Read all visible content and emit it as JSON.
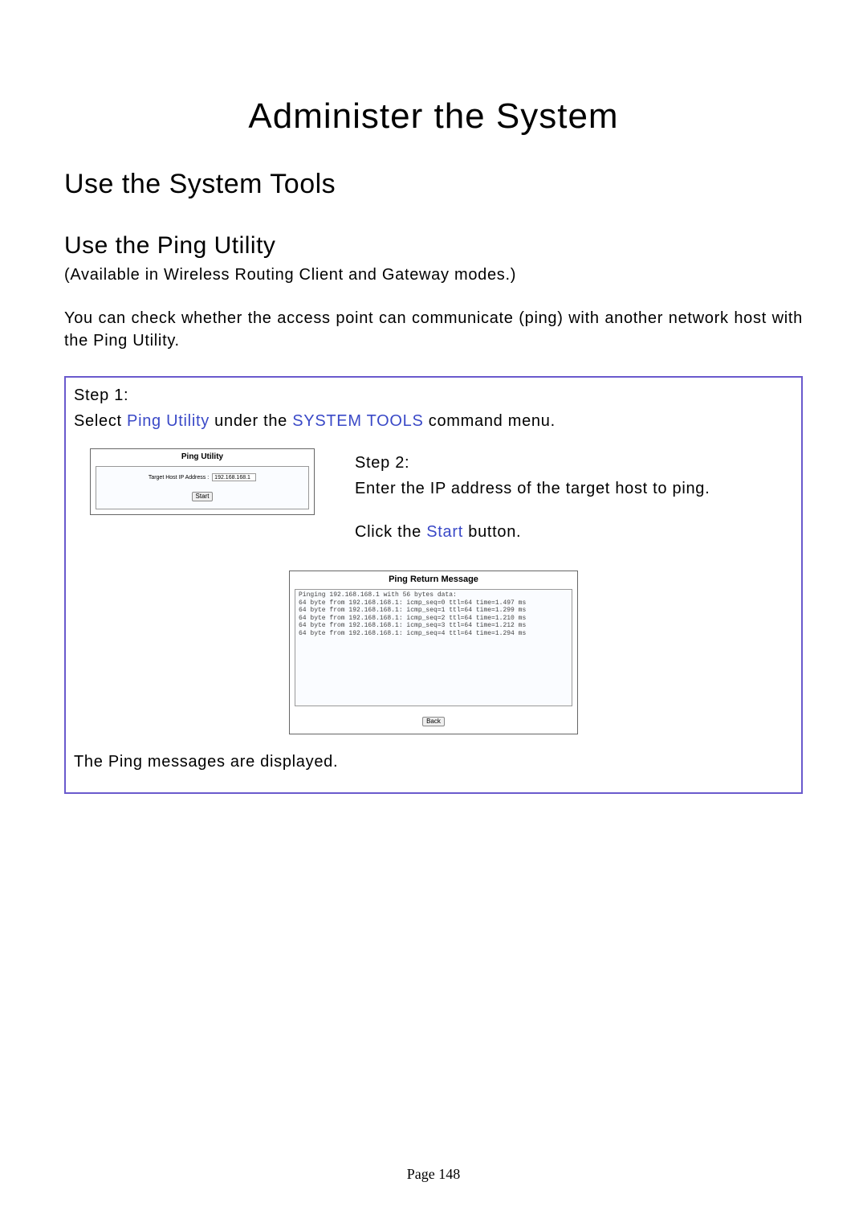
{
  "headings": {
    "h1": "Administer the System",
    "h2": "Use the System Tools",
    "h3": "Use the Ping Utility"
  },
  "paragraphs": {
    "avail": "(Available in Wireless Routing Client and Gateway modes.)",
    "desc": "You can check whether the access point can communicate (ping) with another network host with the Ping Utility."
  },
  "step1": {
    "label": "Step 1:",
    "pre": "Select ",
    "link": "Ping Utility",
    "mid": " under the ",
    "menu": "SYSTEM TOOLS",
    "post": " command menu."
  },
  "step2": {
    "label": "Step 2:",
    "line1": "Enter the IP address of the target host to ping.",
    "click_pre": "Click the ",
    "start_word": "Start",
    "click_post": " button."
  },
  "ping_panel": {
    "title": "Ping Utility",
    "field_label": "Target Host IP Address :",
    "ip_value": "192.168.168.1",
    "start_btn": "Start"
  },
  "return_panel": {
    "title": "Ping Return Message",
    "lines": "Pinging 192.168.168.1 with 56 bytes data:\n64 byte from 192.168.168.1: icmp_seq=0 ttl=64 time=1.497 ms\n64 byte from 192.168.168.1: icmp_seq=1 ttl=64 time=1.299 ms\n64 byte from 192.168.168.1: icmp_seq=2 ttl=64 time=1.210 ms\n64 byte from 192.168.168.1: icmp_seq=3 ttl=64 time=1.212 ms\n64 byte from 192.168.168.1: icmp_seq=4 ttl=64 time=1.294 ms",
    "back_btn": "Back"
  },
  "displayed": "The Ping messages are displayed.",
  "page_number": "Page 148"
}
